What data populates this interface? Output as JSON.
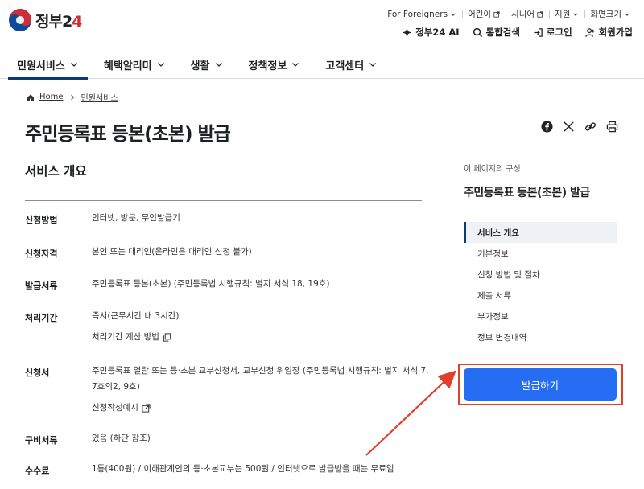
{
  "header": {
    "logo_text": "정부",
    "logo_num": "2",
    "logo_num2": "4",
    "util_top": [
      {
        "label": "For Foreigners",
        "icon": "chevron-down-icon"
      },
      {
        "label": "어린이",
        "icon": "external-link-icon"
      },
      {
        "label": "시니어",
        "icon": "external-link-icon"
      },
      {
        "label": "지원",
        "icon": "chevron-down-icon"
      },
      {
        "label": "화면크기",
        "icon": "chevron-down-icon"
      }
    ],
    "util_bottom": [
      {
        "label": "정부24 AI",
        "icon": "ai-icon"
      },
      {
        "label": "통합검색",
        "icon": "search-icon"
      },
      {
        "label": "로그인",
        "icon": "login-icon"
      },
      {
        "label": "회원가입",
        "icon": "user-add-icon"
      }
    ],
    "gnb": [
      {
        "label": "민원서비스",
        "active": true
      },
      {
        "label": "혜택알리미",
        "active": false
      },
      {
        "label": "생활",
        "active": false
      },
      {
        "label": "정책정보",
        "active": false
      },
      {
        "label": "고객센터",
        "active": false
      }
    ]
  },
  "breadcrumb": {
    "home": "Home",
    "current": "민원서비스"
  },
  "page_title": "주민등록표 등본(초본) 발급",
  "section_title": "서비스 개요",
  "info_rows": [
    {
      "label": "신청방법",
      "value": "인터넷, 방문, 무인발급기"
    },
    {
      "label": "신청자격",
      "value": "본인 또는 대리인(온라인은 대리인 신청 불가)"
    },
    {
      "label": "발급서류",
      "value": "주민등록표 등본(초본) (주민등록법 시행규칙: 별지 서식 18, 19호)"
    },
    {
      "label": "처리기간",
      "value": "즉시(근무시간 내 3시간)",
      "sub": "처리기간 계산 방법"
    },
    {
      "label": "신청서",
      "value": "주민등록표 열람 또는 등·초본 교부신청서, 교부신청 위임장 (주민등록법 시행규칙: 별지 서식 7, 7호의2, 9호)",
      "sub": "신청작성예시"
    },
    {
      "label": "구비서류",
      "value": "있음 (하단 참조)"
    },
    {
      "label": "수수료",
      "value": "1통(400원) / 이해관계인의 등·초본교부는 500원 / 인터넷으로 발급받을 때는 무료임"
    }
  ],
  "side": {
    "caption": "이 페이지의 구성",
    "title": "주민등록표 등본(초본) 발급",
    "nav": [
      "서비스 개요",
      "기본정보",
      "신청 방법 및 절차",
      "제출 서류",
      "부가정보",
      "정보 변경내역"
    ],
    "apply_label": "발급하기"
  },
  "colors": {
    "primary": "#256ef4",
    "navy": "#0b3b75",
    "highlight": "#e0402b"
  }
}
